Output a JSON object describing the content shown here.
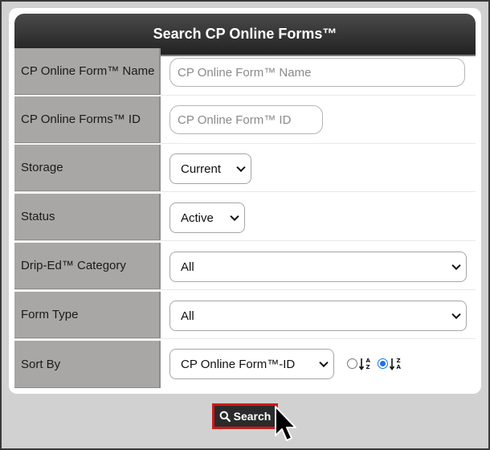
{
  "header": {
    "title": "Search CP Online Forms™"
  },
  "fields": {
    "form_name": {
      "label": "CP Online Form™ Name",
      "placeholder": "CP Online Form™ Name"
    },
    "form_id": {
      "label": "CP Online Forms™ ID",
      "placeholder": "CP Online Form™ ID"
    },
    "storage": {
      "label": "Storage",
      "selected": "Current"
    },
    "status": {
      "label": "Status",
      "selected": "Active"
    },
    "category": {
      "label": "Drip-Ed™ Category",
      "selected": "All"
    },
    "form_type": {
      "label": "Form Type",
      "selected": "All"
    },
    "sort_by": {
      "label": "Sort By",
      "selected": "CP Online Form™-ID",
      "order_options": [
        "sort-ascending-az-icon",
        "sort-descending-za-icon"
      ],
      "order_selected": "sort-descending-za-icon"
    }
  },
  "search_button": {
    "label": "Search",
    "icon": "search-icon"
  },
  "colors": {
    "header": "#2a2a2a",
    "label_bg": "#a9a7a6",
    "highlight": "#d01818",
    "page_bg": "#d1d1d1"
  }
}
